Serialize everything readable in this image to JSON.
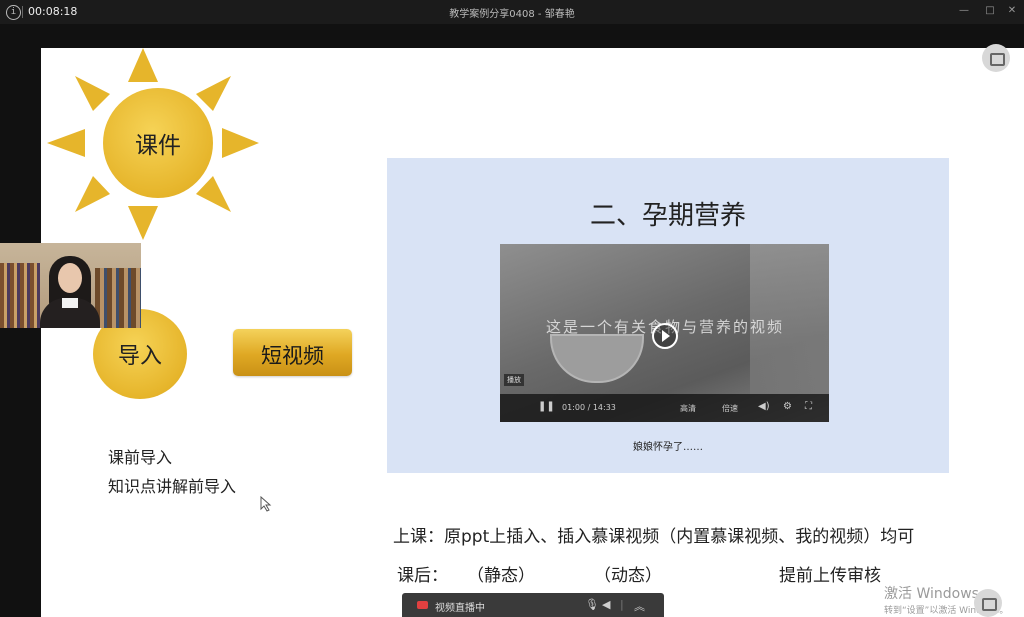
{
  "topbar": {
    "info_icon": "info-icon",
    "elapsed": "00:08:18",
    "title": "教学案例分享0408 - 邹春艳"
  },
  "slide": {
    "courseware_label": "课件",
    "intro_label": "导入",
    "short_video_label": "短视频",
    "intro_lines": [
      "课前导入",
      "知识点讲解前导入"
    ],
    "panel": {
      "title": "二、孕期营养",
      "video_subtitle": "这是一个有关食物与营养的视频",
      "video_badge": "播放",
      "video_time": "01:00 / 14:33",
      "video_controls": [
        "高清",
        "倍速"
      ],
      "caption": "娘娘怀孕了……"
    },
    "in_class": "上课：原ppt上插入、插入慕课视频（内置慕课视频、我的视频）均可",
    "after_class": {
      "label": "课后：",
      "static": "（静态）",
      "dynamic": "（动态）",
      "note": "提前上传审核"
    }
  },
  "toolbar": {
    "status": "视频直播中",
    "icons": [
      "mic-icon",
      "speaker-icon",
      "collapse-icon"
    ]
  },
  "watermark": {
    "line1": "激活 Windows",
    "line2": "转到“设置”以激活 Windows。"
  },
  "colors": {
    "gold": "#e6b52b",
    "panel_bg": "#d9e3f5",
    "topbar_bg": "#1b1b1b"
  }
}
